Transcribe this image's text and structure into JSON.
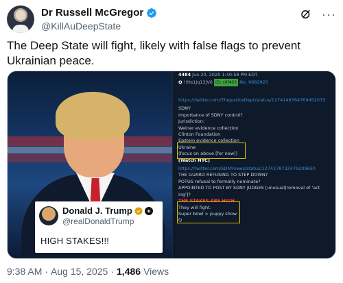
{
  "author": {
    "display_name": "Dr Russell McGregor",
    "handle": "@KillAuDeepState",
    "avatar_icon": "avatar-photo",
    "verified_icon": "verified-badge-icon",
    "verified_color": "#1d9bf0"
  },
  "actions": {
    "grok_icon": "grok-icon",
    "more_label": "···"
  },
  "tweet": {
    "text": "The Deep State will fight, likely with false flags to prevent Ukrainian peace."
  },
  "media": {
    "embedded_post": {
      "name": "Donald J. Trump",
      "handle": "@realDonaldTrump",
      "text": "HIGH STAKES!!!",
      "badge_colors": [
        "#d9a100",
        "#0f1419"
      ]
    },
    "q_drop": {
      "header_line1": "4484",
      "header_line1_rest": "Jun 20, 2020 1:40:58 PM EDT",
      "header_line2_q": "Q",
      "header_line2_id": "!!Hs1Jq13jV6",
      "header_line2_tag": "ID: c6f403",
      "header_line2_no": "No. 9682925",
      "lines": [
        {
          "text": "https://twitter.com/TheJusticeDept/status/1274148764769452033",
          "style": "link"
        },
        {
          "text": "SDNY",
          "style": "normal"
        },
        {
          "text": "Importance of SDNY control?",
          "style": "normal"
        },
        {
          "text": "Jurisdiction:",
          "style": "normal"
        },
        {
          "text": "Weiner evidence collection",
          "style": "normal"
        },
        {
          "text": "Clinton Foundation",
          "style": "normal"
        },
        {
          "text": "Epstein evidence collection",
          "style": "normal"
        },
        {
          "text": "Ukraine",
          "style": "normal"
        },
        {
          "text": "(focus on above [for now])",
          "style": "normal"
        },
        {
          "text": "[Watch NYC]",
          "style": "bold"
        },
        {
          "text": "https://twitter.com/SDNYnews/status/1274178732479209650",
          "style": "link"
        },
        {
          "text": "THE GUARD REFUSING TO STEP DOWN?",
          "style": "normal"
        },
        {
          "text": "POTUS refusal to formally nominate?",
          "style": "normal"
        },
        {
          "text": "APPOINTED TO POST BY SDNY JUDGES [unusual]removal of 'act",
          "style": "normal"
        },
        {
          "text": "ing']?",
          "style": "normal"
        },
        {
          "text": "THE STAKES ARE HIGH.",
          "style": "red"
        },
        {
          "text": "They will fight.",
          "style": "normal"
        },
        {
          "text": "Super bowl > puppy show",
          "style": "normal"
        },
        {
          "text": "Q",
          "style": "normal"
        }
      ]
    }
  },
  "footer": {
    "time": "9:38 AM",
    "separator": "·",
    "date": "Aug 15, 2025",
    "views_count": "1,486",
    "views_label": "Views"
  }
}
